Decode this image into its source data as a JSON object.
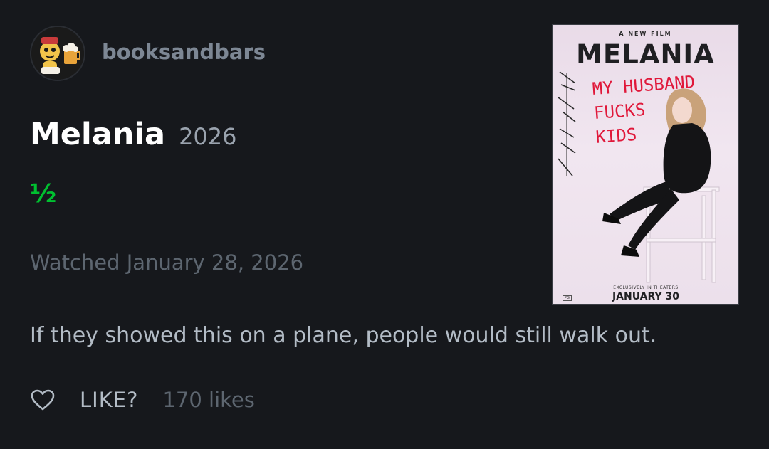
{
  "author": {
    "username": "booksandbars",
    "avatar_icon": "avatar-cartoon-icon"
  },
  "film": {
    "title": "Melania",
    "year": "2026"
  },
  "rating": {
    "display": "½",
    "stars": 0.5,
    "color": "#00c030"
  },
  "watched": {
    "text": "Watched January 28, 2026"
  },
  "review": {
    "text": "If they showed this on a plane, people would still walk out."
  },
  "like": {
    "icon": "heart-icon",
    "label": "LIKE?",
    "count": "170 likes"
  },
  "poster": {
    "kicker": "A NEW FILM",
    "title": "MELANIA",
    "graffiti": "MY HUSBAND\nFUCKS\nKIDS",
    "tagline": "EXCLUSIVELY IN THEATERS",
    "date": "JANUARY 30",
    "rating_badge": "PG"
  },
  "colors": {
    "background": "#16181c",
    "username": "#7d8794",
    "title": "#ffffff",
    "muted": "#5d6670",
    "body": "#b3bcc6",
    "graffiti": "#e0183a"
  }
}
